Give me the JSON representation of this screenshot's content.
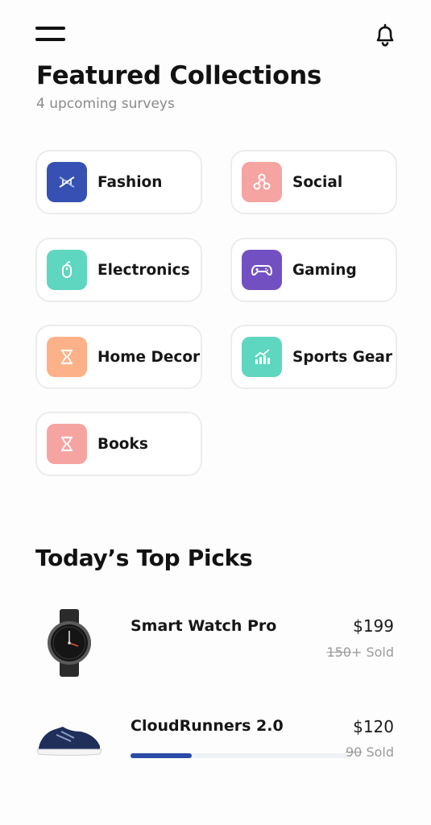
{
  "header": {
    "menu_icon": "hamburger-menu-icon",
    "notification_icon": "bell-icon"
  },
  "featured": {
    "title": "Featured Collections",
    "subtitle": "4 upcoming surveys"
  },
  "collections": [
    {
      "label": "Fashion",
      "icon": "dna-icon",
      "color": "#3651b3"
    },
    {
      "label": "Social",
      "icon": "network-icon",
      "color": "#f6a4a1"
    },
    {
      "label": "Electronics",
      "icon": "mouse-icon",
      "color": "#5fd6bf"
    },
    {
      "label": "Gaming",
      "icon": "gamepad-icon",
      "color": "#7350c2"
    },
    {
      "label": "Home Decor",
      "icon": "hourglass-icon",
      "color": "#fdb188"
    },
    {
      "label": "Sports Gear",
      "icon": "bar-chart-icon",
      "color": "#5fd6bf"
    },
    {
      "label": "Books",
      "icon": "hourglass-icon",
      "color": "#f6a4a1"
    }
  ],
  "top_picks": {
    "title": "Today’s Top Picks",
    "items": [
      {
        "name": "Smart Watch Pro",
        "price": "$199",
        "sold_count": "150",
        "sold_suffix": "+ Sold",
        "image": "smart-watch",
        "progress": null
      },
      {
        "name": "CloudRunners 2.0",
        "price": "$120",
        "sold_count": "90",
        "sold_suffix": " Sold",
        "image": "running-shoe",
        "progress": 0.28
      }
    ]
  }
}
